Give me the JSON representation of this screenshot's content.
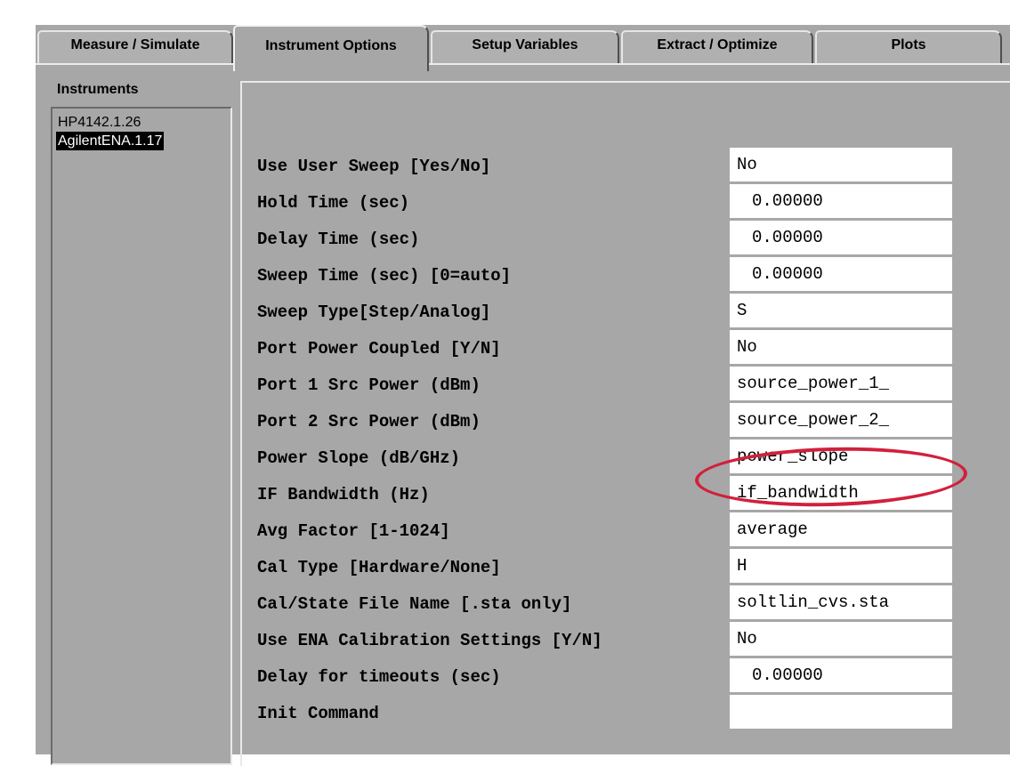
{
  "tabs": [
    {
      "label": "Measure / Simulate",
      "active": false
    },
    {
      "label": "Instrument Options",
      "active": true
    },
    {
      "label": "Setup Variables",
      "active": false
    },
    {
      "label": "Extract / Optimize",
      "active": false
    },
    {
      "label": "Plots",
      "active": false
    }
  ],
  "instruments": {
    "title": "Instruments",
    "items": [
      {
        "label": "HP4142.1.26",
        "selected": false
      },
      {
        "label": "AgilentENA.1.17",
        "selected": true
      }
    ]
  },
  "options": [
    {
      "label": "Use User Sweep [Yes/No]",
      "value": "No"
    },
    {
      "label": "Hold Time (sec)",
      "value": "0.00000"
    },
    {
      "label": "Delay Time (sec)",
      "value": "0.00000"
    },
    {
      "label": "Sweep Time (sec) [0=auto]",
      "value": "0.00000"
    },
    {
      "label": "Sweep Type[Step/Analog]",
      "value": "S"
    },
    {
      "label": "Port Power Coupled [Y/N]",
      "value": "No"
    },
    {
      "label": "Port 1 Src Power (dBm)",
      "value": "source_power_1_"
    },
    {
      "label": "Port 2 Src Power (dBm)",
      "value": "source_power_2_"
    },
    {
      "label": "Power Slope (dB/GHz)",
      "value": "power_slope"
    },
    {
      "label": "IF Bandwidth (Hz)",
      "value": "if_bandwidth"
    },
    {
      "label": "Avg Factor [1-1024]",
      "value": "average"
    },
    {
      "label": "Cal Type [Hardware/None]",
      "value": "H"
    },
    {
      "label": "Cal/State File Name [.sta only]",
      "value": "soltlin_cvs.sta"
    },
    {
      "label": "Use ENA Calibration Settings [Y/N]",
      "value": "No"
    },
    {
      "label": "Delay for timeouts (sec)",
      "value": "0.00000"
    },
    {
      "label": "Init Command",
      "value": ""
    }
  ],
  "colors": {
    "panel": "#a7a7a7",
    "annotation": "#d1203d",
    "selection": "#000000"
  }
}
